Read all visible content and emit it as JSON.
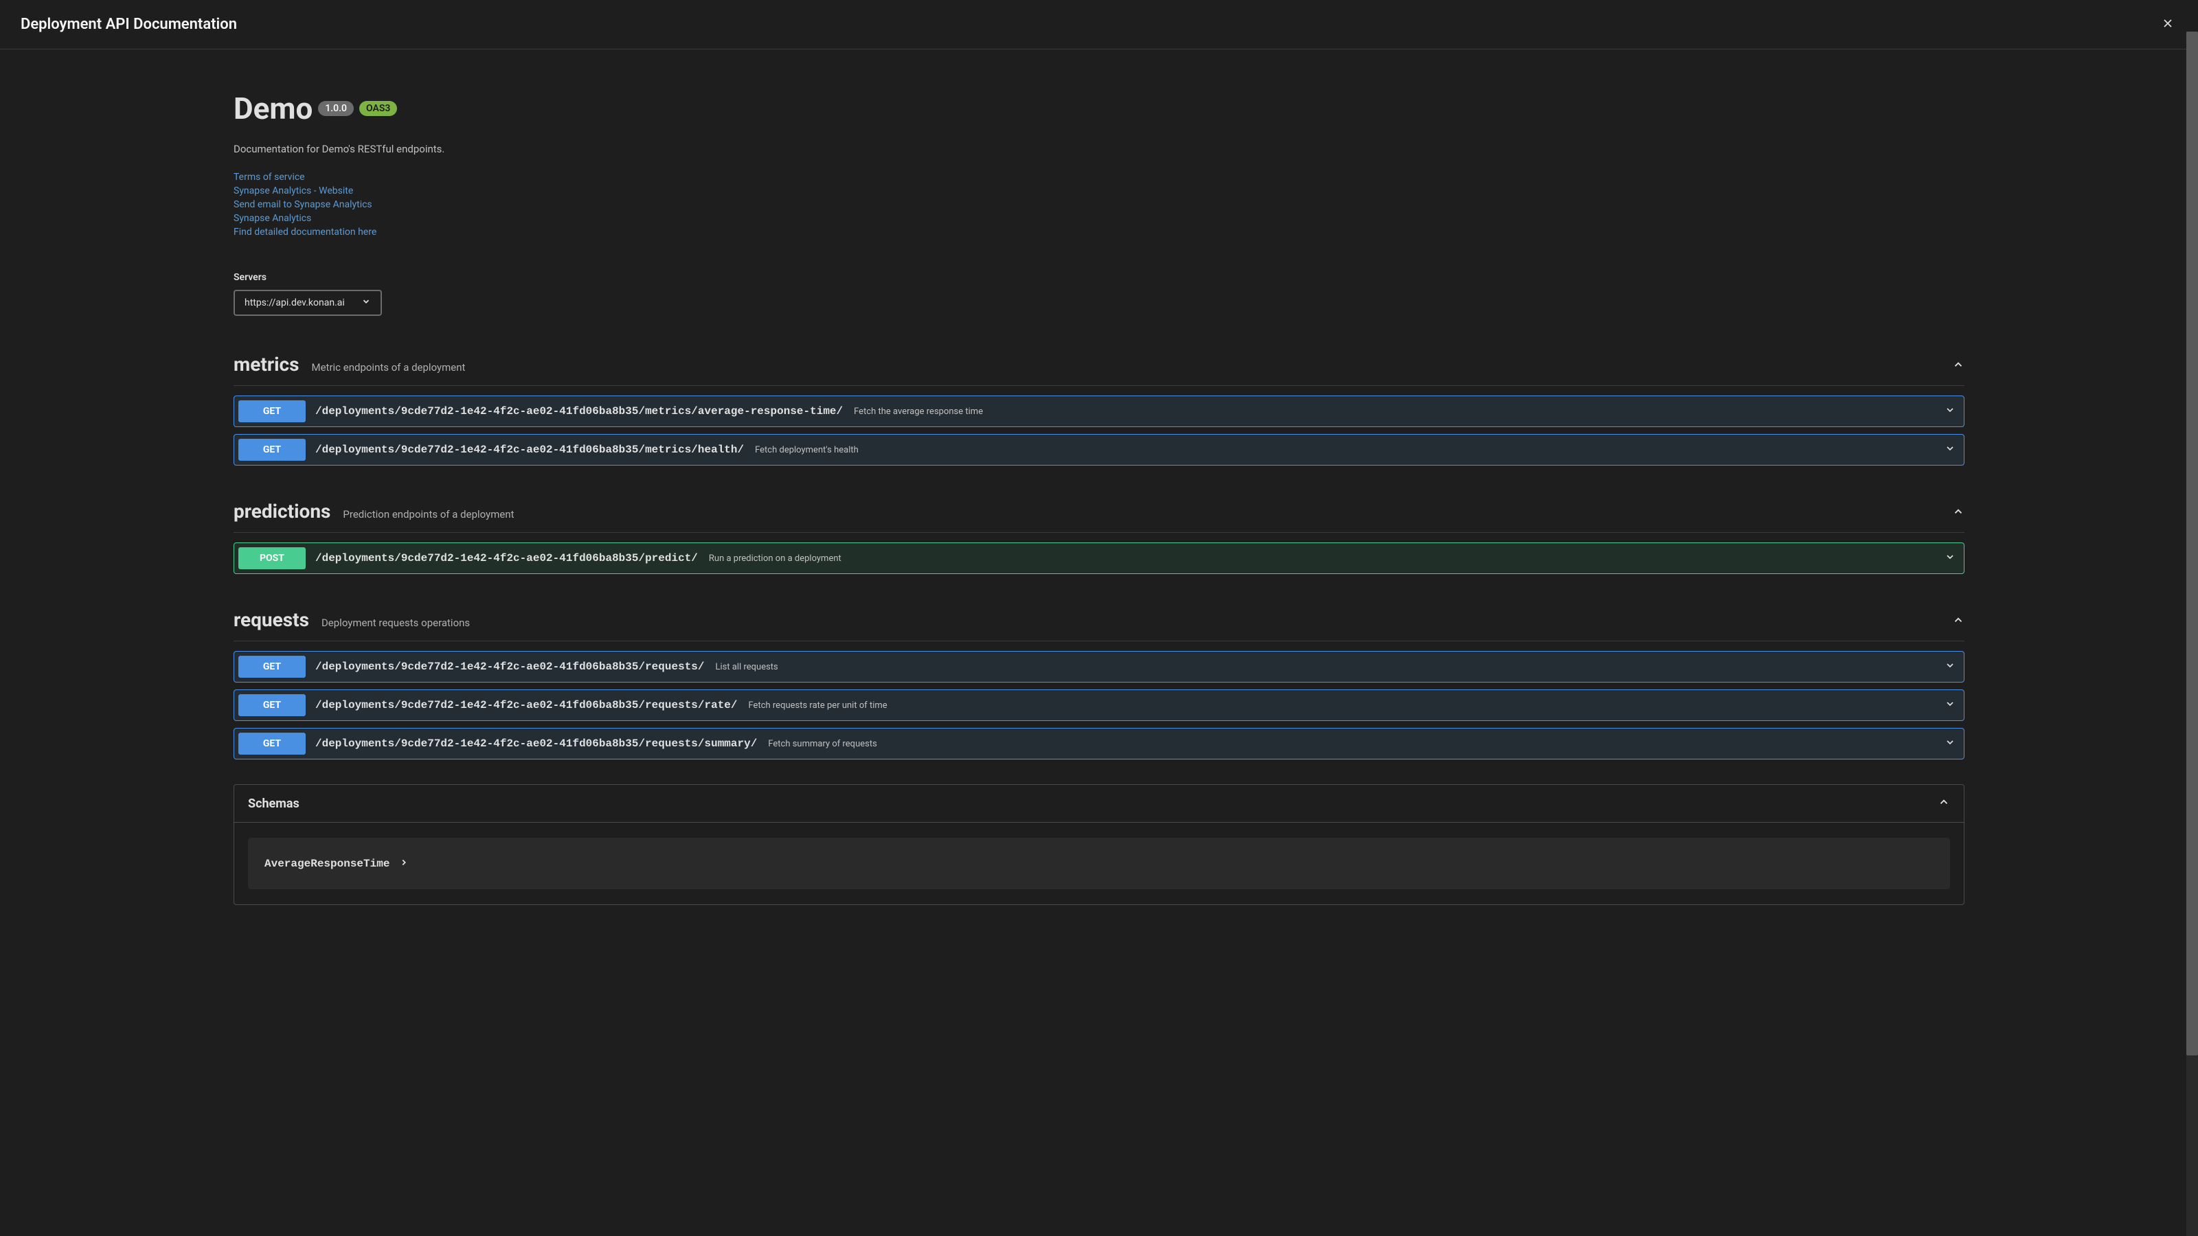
{
  "header": {
    "title": "Deployment API Documentation"
  },
  "api": {
    "name": "Demo",
    "version": "1.0.0",
    "oas": "OAS3",
    "description": "Documentation for Demo's RESTful endpoints."
  },
  "links": {
    "terms": "Terms of service",
    "website": "Synapse Analytics - Website",
    "email": "Send email to Synapse Analytics",
    "license": "Synapse Analytics",
    "docs": "Find detailed documentation here"
  },
  "servers": {
    "label": "Servers",
    "selected": "https://api.dev.konan.ai"
  },
  "sections": [
    {
      "name": "metrics",
      "desc": "Metric endpoints of a deployment"
    },
    {
      "name": "predictions",
      "desc": "Prediction endpoints of a deployment"
    },
    {
      "name": "requests",
      "desc": "Deployment requests operations"
    }
  ],
  "endpoints": {
    "metrics": [
      {
        "method": "GET",
        "path": "/deployments/9cde77d2-1e42-4f2c-ae02-41fd06ba8b35/metrics/average-response-time/",
        "desc": "Fetch the average response time"
      },
      {
        "method": "GET",
        "path": "/deployments/9cde77d2-1e42-4f2c-ae02-41fd06ba8b35/metrics/health/",
        "desc": "Fetch deployment's health"
      }
    ],
    "predictions": [
      {
        "method": "POST",
        "path": "/deployments/9cde77d2-1e42-4f2c-ae02-41fd06ba8b35/predict/",
        "desc": "Run a prediction on a deployment"
      }
    ],
    "requests": [
      {
        "method": "GET",
        "path": "/deployments/9cde77d2-1e42-4f2c-ae02-41fd06ba8b35/requests/",
        "desc": "List all requests"
      },
      {
        "method": "GET",
        "path": "/deployments/9cde77d2-1e42-4f2c-ae02-41fd06ba8b35/requests/rate/",
        "desc": "Fetch requests rate per unit of time"
      },
      {
        "method": "GET",
        "path": "/deployments/9cde77d2-1e42-4f2c-ae02-41fd06ba8b35/requests/summary/",
        "desc": "Fetch summary of requests"
      }
    ]
  },
  "schemas": {
    "title": "Schemas",
    "items": [
      {
        "name": "AverageResponseTime"
      }
    ]
  }
}
